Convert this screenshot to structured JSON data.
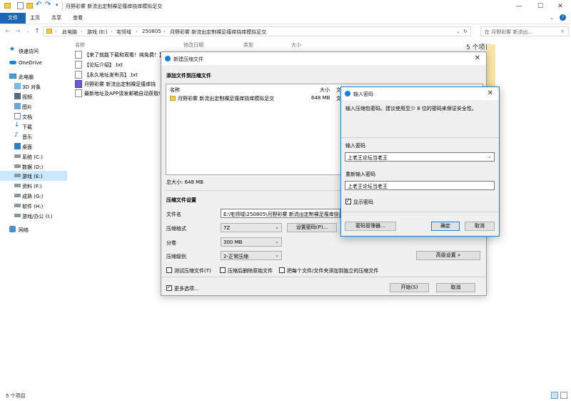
{
  "window": {
    "title": "月野彩雾 新流出定制裸足瘙痒挠痒模拟足交",
    "tabs": [
      "文件",
      "主页",
      "共享",
      "查看"
    ]
  },
  "address": {
    "crumbs": [
      "此电脑",
      "游戏 (E:)",
      "宅领域",
      "250805",
      "月野彩雾 新流出定制裸足瘙痒挠痒模拟足交"
    ],
    "search_placeholder": "在 月野彩雾 新流出..."
  },
  "sidebar": {
    "items": [
      {
        "label": "快速访问",
        "icon": "star-icon"
      },
      {
        "label": "OneDrive",
        "icon": "cloud-icon"
      },
      {
        "label": "此电脑",
        "icon": "computer-icon"
      },
      {
        "label": "3D 对象",
        "icon": "cube-icon"
      },
      {
        "label": "视频",
        "icon": "video-icon"
      },
      {
        "label": "图片",
        "icon": "picture-icon"
      },
      {
        "label": "文档",
        "icon": "document-icon"
      },
      {
        "label": "下载",
        "icon": "download-icon"
      },
      {
        "label": "音乐",
        "icon": "music-icon"
      },
      {
        "label": "桌面",
        "icon": "desktop-icon"
      },
      {
        "label": "系统 (C:)",
        "icon": "drive-icon"
      },
      {
        "label": "数据 (D:)",
        "icon": "drive-icon"
      },
      {
        "label": "游戏 (E:)",
        "icon": "drive-icon"
      },
      {
        "label": "资料 (F:)",
        "icon": "drive-icon"
      },
      {
        "label": "成熟 (G:)",
        "icon": "drive-icon"
      },
      {
        "label": "软件 (H:)",
        "icon": "drive-icon"
      },
      {
        "label": "游戏/办公 (I:)",
        "icon": "drive-icon"
      },
      {
        "label": "网络",
        "icon": "network-icon"
      }
    ]
  },
  "filelist": {
    "columns": [
      "名称",
      "修改日期",
      "类型",
      "大小"
    ],
    "files": [
      "【来了就能下载和观看！纯免费！】",
      "【论坛介绍】.txt",
      "【永久地址发布页】.txt",
      "月野彩雾 新流出定制裸足瘙痒挠",
      "最新地址及APP请发邮箱自动获取!"
    ],
    "item_count": "5 个项目"
  },
  "status": {
    "text": "5 个项目"
  },
  "compress_dialog": {
    "title": "新建压缩文件",
    "add_section": "添加文件到压缩文件",
    "list_headers": [
      "名称",
      "大小",
      "文"
    ],
    "entry_name": "月野彩雾 新流出定制裸足瘙痒挠痒模拟足交",
    "entry_size": "648 MB",
    "entry_type": "文",
    "total": "总大小: 648 MB",
    "settings_section": "压缩文件设置",
    "filename_label": "文件名",
    "filename_value": "E:\\宅领域\\250805\\月野彩雾 新流出定制裸足瘙痒挠痒模拟足交",
    "format_label": "压缩格式",
    "format_value": "7Z",
    "volume_label": "分卷",
    "volume_value": "300 MB",
    "level_label": "压缩级别",
    "level_value": "2-正常压缩",
    "set_password_btn": "设置密码(P)...",
    "advanced_btn": "高级设置 »",
    "test_label": "测试压缩文件(T)",
    "delete_label": "压缩后删除原始文件",
    "separate_label": "把每个文件/文件夹添加到独立的压缩文件",
    "more_label": "更多选项...",
    "start_btn": "开始(S)",
    "cancel_btn": "取消"
  },
  "password_dialog": {
    "title": "输入密码",
    "hint": "输入压缩包密码。建议使用至少 8 位的密码来保证安全性。",
    "enter_label": "输入密码",
    "enter_value": "上老王论坛当老王",
    "reenter_label": "重新输入密码",
    "reenter_value": "上老王论坛当老王",
    "show_label": "显示密码",
    "manager_btn": "密码管理器...",
    "ok_btn": "确定",
    "cancel_btn": "取消"
  },
  "colors": {
    "accent": "#1a68b5",
    "selection": "#cce8ff"
  }
}
